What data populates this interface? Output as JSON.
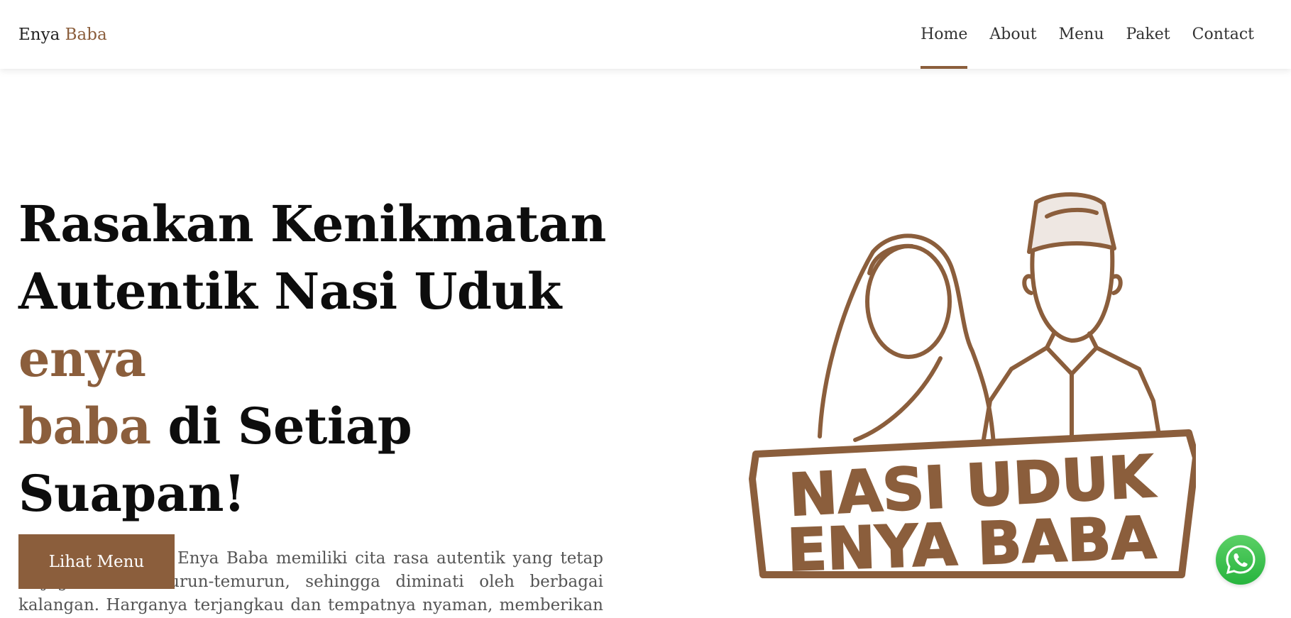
{
  "brand": {
    "part1": "Enya",
    "part2": "Baba"
  },
  "nav": {
    "items": [
      {
        "label": "Home",
        "active": true
      },
      {
        "label": "About",
        "active": false
      },
      {
        "label": "Menu",
        "active": false
      },
      {
        "label": "Paket",
        "active": false
      },
      {
        "label": "Contact",
        "active": false
      }
    ]
  },
  "hero": {
    "title_line1": "Rasakan Kenikmatan",
    "title_line2_main": "Autentik Nasi Uduk",
    "title_accent1": "enya",
    "title_accent2": "baba",
    "title_line3_main": "di Setiap Suapan!",
    "description": "Nasi uduk Betawi Enya Baba memiliki cita rasa autentik yang tetap terjaga secara turun-temurun, sehingga diminati oleh berbagai kalangan. Harganya terjangkau dan tempatnya nyaman, memberikan suasana hangat seperti di rumah nenek.",
    "cta_label": "Lihat Menu"
  },
  "logo": {
    "line1": "NASI UDUK",
    "line2": "ENYA BABA"
  },
  "colors": {
    "accent": "#8b5e3c",
    "whatsapp": "#27b43e"
  },
  "icons": {
    "floating": "whatsapp-icon"
  }
}
